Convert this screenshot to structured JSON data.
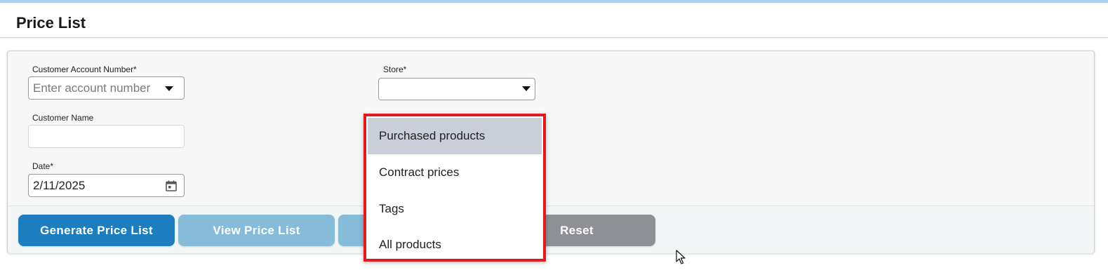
{
  "page": {
    "title": "Price List"
  },
  "form": {
    "account_label": "Customer Account Number*",
    "account_placeholder": "Enter account number",
    "store_label": "Store*",
    "store_value": "",
    "name_label": "Customer Name",
    "name_value": "",
    "date_label": "Date*",
    "date_value": "2/11/2025"
  },
  "buttons": {
    "generate": "Generate Price List",
    "view": "View Price List",
    "hidden": "",
    "reset": "Reset"
  },
  "dropdown": {
    "items": [
      "Purchased products",
      "Contract prices",
      "Tags",
      "All products"
    ],
    "selected_index": 0
  },
  "colors": {
    "primary": "#1c7dbf",
    "disabled": "#86bcd9",
    "reset": "#8e9095",
    "highlight_border": "#e01b1b",
    "selected_item": "#c9ced8"
  },
  "icons": [
    "chevron-down-icon",
    "calendar-icon",
    "mouse-cursor-icon"
  ]
}
